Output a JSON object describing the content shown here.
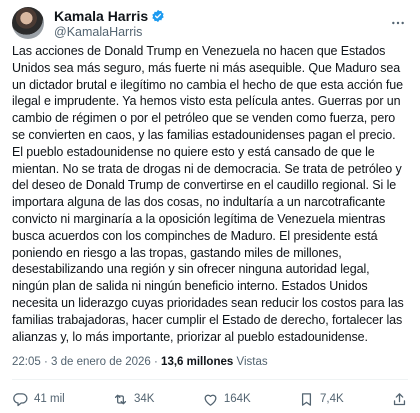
{
  "author": {
    "name": "Kamala Harris",
    "handle": "@KamalaHarris"
  },
  "post": {
    "text": "Las acciones de Donald Trump en Venezuela no hacen que Estados Unidos sea más seguro, más fuerte ni más asequible. Que Maduro sea un dictador brutal e ilegítimo no cambia el hecho de que esta acción fue ilegal e imprudente. Ya hemos visto esta película antes. Guerras por un cambio de régimen o por el petróleo que se venden como fuerza, pero se convierten en caos, y las familias estadounidenses pagan el precio. El pueblo estadounidense no quiere esto y está cansado de que le mientan. No se trata de drogas ni de democracia. Se trata de petróleo y del deseo de Donald Trump de convertirse en el caudillo regional. Si le importara alguna de las dos cosas, no indultaría a un narcotraficante convicto ni marginaría a la oposición legítima de Venezuela mientras busca acuerdos con los compinches de Maduro. El presidente está poniendo en riesgo a las tropas, gastando miles de millones, desestabilizando una región y sin ofrecer ninguna autoridad legal, ningún plan de salida ni ningún beneficio interno. Estados Unidos necesita un liderazgo cuyas prioridades sean reducir los costos para las familias trabajadoras, hacer cumplir el Estado de derecho, fortalecer las alianzas y, lo más importante, priorizar al pueblo estadounidense."
  },
  "meta": {
    "time": "22:05",
    "separator": "·",
    "date": "3 de enero de 2026",
    "views_count": "13,6 millones",
    "views_label": "Vistas"
  },
  "actions": {
    "replies": "41 mil",
    "reposts": "34K",
    "likes": "164K",
    "bookmarks": "7,4K"
  },
  "colors": {
    "verified": "#1d9bf0",
    "secondary_text": "#536471",
    "primary_text": "#0f1419"
  },
  "icons": [
    "avatar",
    "verified-badge-icon",
    "more-icon",
    "reply-icon",
    "repost-icon",
    "like-icon",
    "bookmark-icon",
    "share-icon"
  ]
}
